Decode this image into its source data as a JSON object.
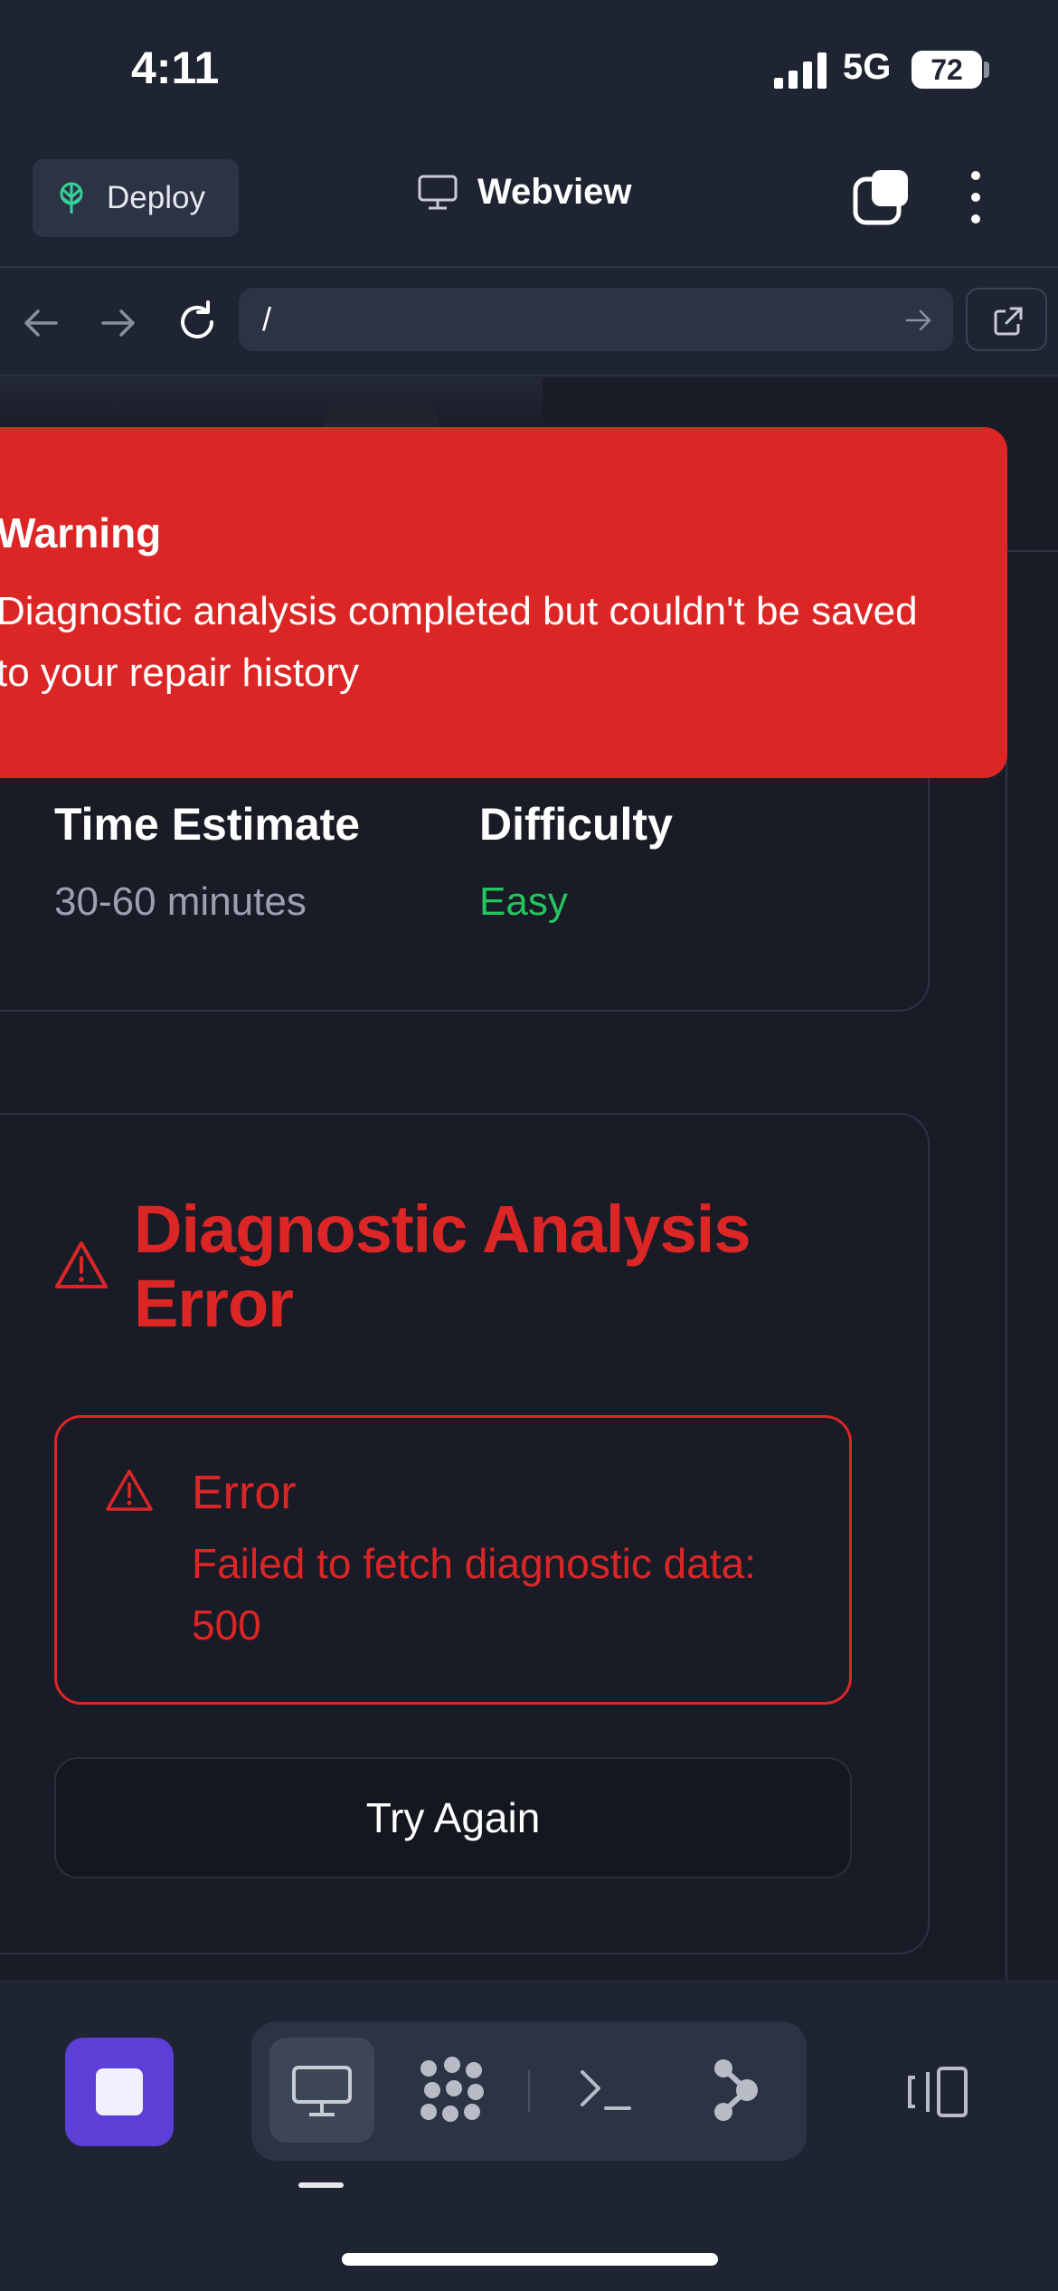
{
  "status_bar": {
    "time": "4:11",
    "network": "5G",
    "battery": "72"
  },
  "toolbar": {
    "deploy_label": "Deploy",
    "title": "Webview"
  },
  "url_bar": {
    "value": "/"
  },
  "toast": {
    "title": "Warning",
    "message": "Diagnostic analysis completed but couldn't be saved to your repair history"
  },
  "estimate_card": {
    "time_label": "Time Estimate",
    "time_value": "30-60 minutes",
    "difficulty_label": "Difficulty",
    "difficulty_value": "Easy"
  },
  "error_card": {
    "heading": "Diagnostic Analysis Error",
    "alert_title": "Error",
    "alert_message": "Failed to fetch diagnostic data: 500",
    "retry_label": "Try Again"
  },
  "colors": {
    "error_red": "#dc2626",
    "success_green": "#22c55e",
    "accent_purple": "#5b3fd6",
    "background": "#191c26"
  },
  "bottom_bar": {
    "icons": [
      "stop-icon",
      "monitor-icon",
      "apps-grid-icon",
      "terminal-icon",
      "git-branch-icon",
      "side-panel-icon"
    ]
  }
}
